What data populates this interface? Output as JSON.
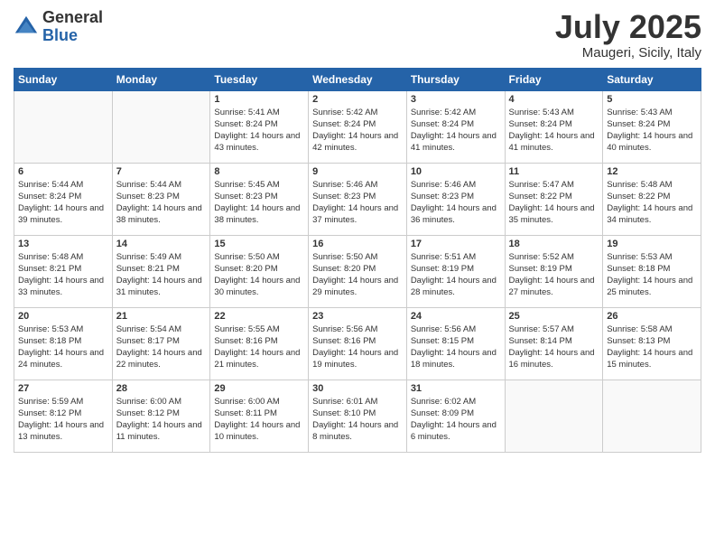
{
  "logo": {
    "general": "General",
    "blue": "Blue"
  },
  "header": {
    "month": "July 2025",
    "location": "Maugeri, Sicily, Italy"
  },
  "weekdays": [
    "Sunday",
    "Monday",
    "Tuesday",
    "Wednesday",
    "Thursday",
    "Friday",
    "Saturday"
  ],
  "weeks": [
    [
      {
        "day": "",
        "sunrise": "",
        "sunset": "",
        "daylight": "",
        "empty": true
      },
      {
        "day": "",
        "sunrise": "",
        "sunset": "",
        "daylight": "",
        "empty": true
      },
      {
        "day": "1",
        "sunrise": "Sunrise: 5:41 AM",
        "sunset": "Sunset: 8:24 PM",
        "daylight": "Daylight: 14 hours and 43 minutes."
      },
      {
        "day": "2",
        "sunrise": "Sunrise: 5:42 AM",
        "sunset": "Sunset: 8:24 PM",
        "daylight": "Daylight: 14 hours and 42 minutes."
      },
      {
        "day": "3",
        "sunrise": "Sunrise: 5:42 AM",
        "sunset": "Sunset: 8:24 PM",
        "daylight": "Daylight: 14 hours and 41 minutes."
      },
      {
        "day": "4",
        "sunrise": "Sunrise: 5:43 AM",
        "sunset": "Sunset: 8:24 PM",
        "daylight": "Daylight: 14 hours and 41 minutes."
      },
      {
        "day": "5",
        "sunrise": "Sunrise: 5:43 AM",
        "sunset": "Sunset: 8:24 PM",
        "daylight": "Daylight: 14 hours and 40 minutes."
      }
    ],
    [
      {
        "day": "6",
        "sunrise": "Sunrise: 5:44 AM",
        "sunset": "Sunset: 8:24 PM",
        "daylight": "Daylight: 14 hours and 39 minutes."
      },
      {
        "day": "7",
        "sunrise": "Sunrise: 5:44 AM",
        "sunset": "Sunset: 8:23 PM",
        "daylight": "Daylight: 14 hours and 38 minutes."
      },
      {
        "day": "8",
        "sunrise": "Sunrise: 5:45 AM",
        "sunset": "Sunset: 8:23 PM",
        "daylight": "Daylight: 14 hours and 38 minutes."
      },
      {
        "day": "9",
        "sunrise": "Sunrise: 5:46 AM",
        "sunset": "Sunset: 8:23 PM",
        "daylight": "Daylight: 14 hours and 37 minutes."
      },
      {
        "day": "10",
        "sunrise": "Sunrise: 5:46 AM",
        "sunset": "Sunset: 8:23 PM",
        "daylight": "Daylight: 14 hours and 36 minutes."
      },
      {
        "day": "11",
        "sunrise": "Sunrise: 5:47 AM",
        "sunset": "Sunset: 8:22 PM",
        "daylight": "Daylight: 14 hours and 35 minutes."
      },
      {
        "day": "12",
        "sunrise": "Sunrise: 5:48 AM",
        "sunset": "Sunset: 8:22 PM",
        "daylight": "Daylight: 14 hours and 34 minutes."
      }
    ],
    [
      {
        "day": "13",
        "sunrise": "Sunrise: 5:48 AM",
        "sunset": "Sunset: 8:21 PM",
        "daylight": "Daylight: 14 hours and 33 minutes."
      },
      {
        "day": "14",
        "sunrise": "Sunrise: 5:49 AM",
        "sunset": "Sunset: 8:21 PM",
        "daylight": "Daylight: 14 hours and 31 minutes."
      },
      {
        "day": "15",
        "sunrise": "Sunrise: 5:50 AM",
        "sunset": "Sunset: 8:20 PM",
        "daylight": "Daylight: 14 hours and 30 minutes."
      },
      {
        "day": "16",
        "sunrise": "Sunrise: 5:50 AM",
        "sunset": "Sunset: 8:20 PM",
        "daylight": "Daylight: 14 hours and 29 minutes."
      },
      {
        "day": "17",
        "sunrise": "Sunrise: 5:51 AM",
        "sunset": "Sunset: 8:19 PM",
        "daylight": "Daylight: 14 hours and 28 minutes."
      },
      {
        "day": "18",
        "sunrise": "Sunrise: 5:52 AM",
        "sunset": "Sunset: 8:19 PM",
        "daylight": "Daylight: 14 hours and 27 minutes."
      },
      {
        "day": "19",
        "sunrise": "Sunrise: 5:53 AM",
        "sunset": "Sunset: 8:18 PM",
        "daylight": "Daylight: 14 hours and 25 minutes."
      }
    ],
    [
      {
        "day": "20",
        "sunrise": "Sunrise: 5:53 AM",
        "sunset": "Sunset: 8:18 PM",
        "daylight": "Daylight: 14 hours and 24 minutes."
      },
      {
        "day": "21",
        "sunrise": "Sunrise: 5:54 AM",
        "sunset": "Sunset: 8:17 PM",
        "daylight": "Daylight: 14 hours and 22 minutes."
      },
      {
        "day": "22",
        "sunrise": "Sunrise: 5:55 AM",
        "sunset": "Sunset: 8:16 PM",
        "daylight": "Daylight: 14 hours and 21 minutes."
      },
      {
        "day": "23",
        "sunrise": "Sunrise: 5:56 AM",
        "sunset": "Sunset: 8:16 PM",
        "daylight": "Daylight: 14 hours and 19 minutes."
      },
      {
        "day": "24",
        "sunrise": "Sunrise: 5:56 AM",
        "sunset": "Sunset: 8:15 PM",
        "daylight": "Daylight: 14 hours and 18 minutes."
      },
      {
        "day": "25",
        "sunrise": "Sunrise: 5:57 AM",
        "sunset": "Sunset: 8:14 PM",
        "daylight": "Daylight: 14 hours and 16 minutes."
      },
      {
        "day": "26",
        "sunrise": "Sunrise: 5:58 AM",
        "sunset": "Sunset: 8:13 PM",
        "daylight": "Daylight: 14 hours and 15 minutes."
      }
    ],
    [
      {
        "day": "27",
        "sunrise": "Sunrise: 5:59 AM",
        "sunset": "Sunset: 8:12 PM",
        "daylight": "Daylight: 14 hours and 13 minutes."
      },
      {
        "day": "28",
        "sunrise": "Sunrise: 6:00 AM",
        "sunset": "Sunset: 8:12 PM",
        "daylight": "Daylight: 14 hours and 11 minutes."
      },
      {
        "day": "29",
        "sunrise": "Sunrise: 6:00 AM",
        "sunset": "Sunset: 8:11 PM",
        "daylight": "Daylight: 14 hours and 10 minutes."
      },
      {
        "day": "30",
        "sunrise": "Sunrise: 6:01 AM",
        "sunset": "Sunset: 8:10 PM",
        "daylight": "Daylight: 14 hours and 8 minutes."
      },
      {
        "day": "31",
        "sunrise": "Sunrise: 6:02 AM",
        "sunset": "Sunset: 8:09 PM",
        "daylight": "Daylight: 14 hours and 6 minutes."
      },
      {
        "day": "",
        "sunrise": "",
        "sunset": "",
        "daylight": "",
        "empty": true
      },
      {
        "day": "",
        "sunrise": "",
        "sunset": "",
        "daylight": "",
        "empty": true
      }
    ]
  ]
}
